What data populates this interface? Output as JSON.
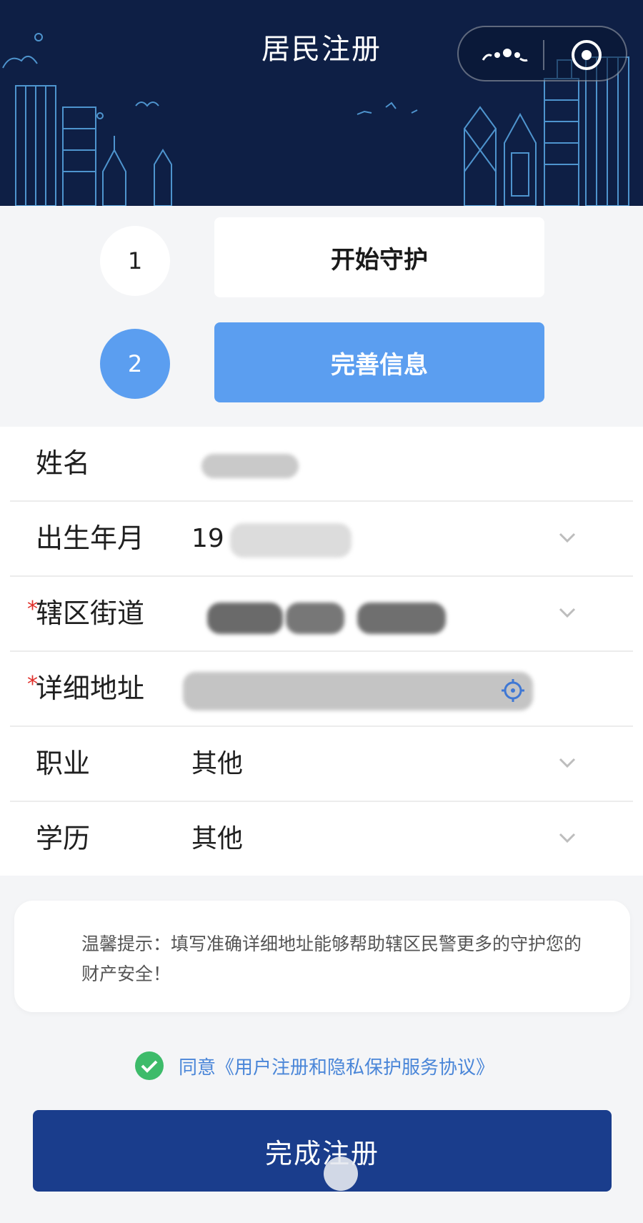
{
  "header": {
    "title": "居民注册",
    "capsule_more_icon": "more-dots-icon",
    "capsule_close_icon": "target-circle-icon"
  },
  "steps": [
    {
      "number": "1",
      "label": "开始守护",
      "active": false
    },
    {
      "number": "2",
      "label": "完善信息",
      "active": true
    }
  ],
  "form": {
    "name": {
      "label": "姓名",
      "value": ""
    },
    "birth": {
      "label": "出生年月",
      "value": "19"
    },
    "district": {
      "label": "辖区街道",
      "required_mark": "*",
      "value": ""
    },
    "address": {
      "label": "详细地址",
      "required_mark": "*",
      "value": ""
    },
    "occupation": {
      "label": "职业",
      "value": "其他"
    },
    "education": {
      "label": "学历",
      "value": "其他"
    }
  },
  "tip": {
    "text": "温馨提示：填写准确详细地址能够帮助辖区民警更多的守护您的财产安全！"
  },
  "agreement": {
    "text": "同意《用户注册和隐私保护服务协议》",
    "checked": true
  },
  "submit": {
    "label": "完成注册"
  },
  "colors": {
    "header_bg": "#0e1f45",
    "active_step": "#5b9ef0",
    "submit_bg": "#1a3d8c",
    "required": "#e0302b",
    "link": "#4a86d8",
    "check": "#3dbb6a"
  }
}
